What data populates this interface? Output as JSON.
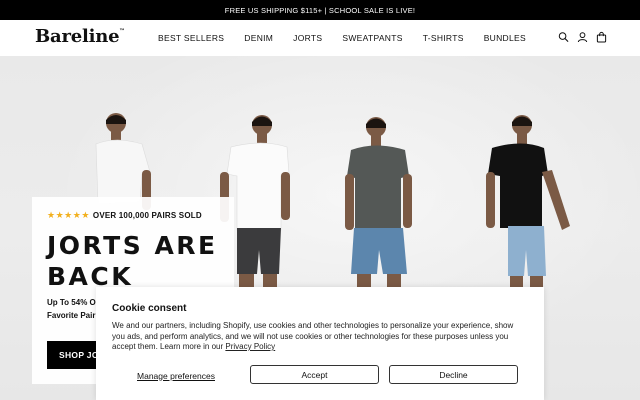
{
  "announcement": "FREE US SHIPPING $115+ | SCHOOL SALE IS LIVE!",
  "header": {
    "logo": "Bareline",
    "logo_mark": "™",
    "nav": [
      "BEST SELLERS",
      "DENIM",
      "JORTS",
      "SWEATPANTS",
      "T-SHIRTS",
      "BUNDLES"
    ],
    "icons": [
      "search-icon",
      "account-icon",
      "cart-icon"
    ]
  },
  "hero": {
    "rating_text": "OVER 100,000 PAIRS SOLD",
    "stars": 5,
    "title": "JORTS ARE BACK",
    "subtitle": "Up To 54% OF\nFavorite Pair l",
    "cta": "SHOP JORTS",
    "star_color": "#f2b01e"
  },
  "cookie": {
    "title": "Cookie consent",
    "body": "We and our partners, including Shopify, use cookies and other technologies to personalize your experience, show you ads, and perform analytics, and we will not use cookies or other technologies for these purposes unless you accept them. Learn more in our ",
    "link": "Privacy Policy",
    "manage": "Manage preferences",
    "accept": "Accept",
    "decline": "Decline"
  }
}
